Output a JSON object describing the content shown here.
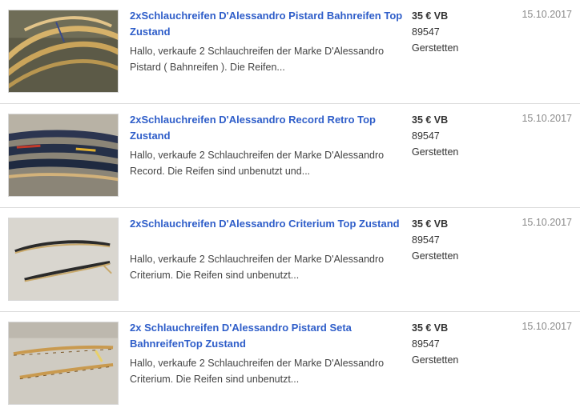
{
  "listings": [
    {
      "title": "2xSchlauchreifen D'Alessandro Pistard Bahnreifen Top Zustand",
      "description": "Hallo, verkaufe 2 Schlauchreifen der Marke D'Alessandro Pistard ( Bahnreifen ). Die Reifen...",
      "price": "35 € VB",
      "zip": "89547",
      "city": "Gerstetten",
      "date": "15.10.2017"
    },
    {
      "title": "2xSchlauchreifen D'Alessandro Record Retro Top Zustand",
      "description": "Hallo, verkaufe 2 Schlauchreifen der Marke D'Alessandro Record. Die Reifen sind unbenutzt und...",
      "price": "35 € VB",
      "zip": "89547",
      "city": "Gerstetten",
      "date": "15.10.2017"
    },
    {
      "title": "2xSchlauchreifen D'Alessandro Criterium Top Zustand",
      "description": "Hallo, verkaufe 2 Schlauchreifen der Marke D'Alessandro Criterium. Die Reifen sind unbenutzt...",
      "price": "35 € VB",
      "zip": "89547",
      "city": "Gerstetten",
      "date": "15.10.2017"
    },
    {
      "title": "2x Schlauchreifen D'Alessandro Pistard Seta BahnreifenTop Zustand",
      "description": "Hallo, verkaufe 2 Schlauchreifen der Marke D'Alessandro Criterium. Die Reifen sind unbenutzt...",
      "price": "35 € VB",
      "zip": "89547",
      "city": "Gerstetten",
      "date": "15.10.2017"
    }
  ],
  "colors": {
    "title_link": "#2f5ec9",
    "date_text": "#8a8a8a",
    "divider": "#dcdcdc"
  }
}
